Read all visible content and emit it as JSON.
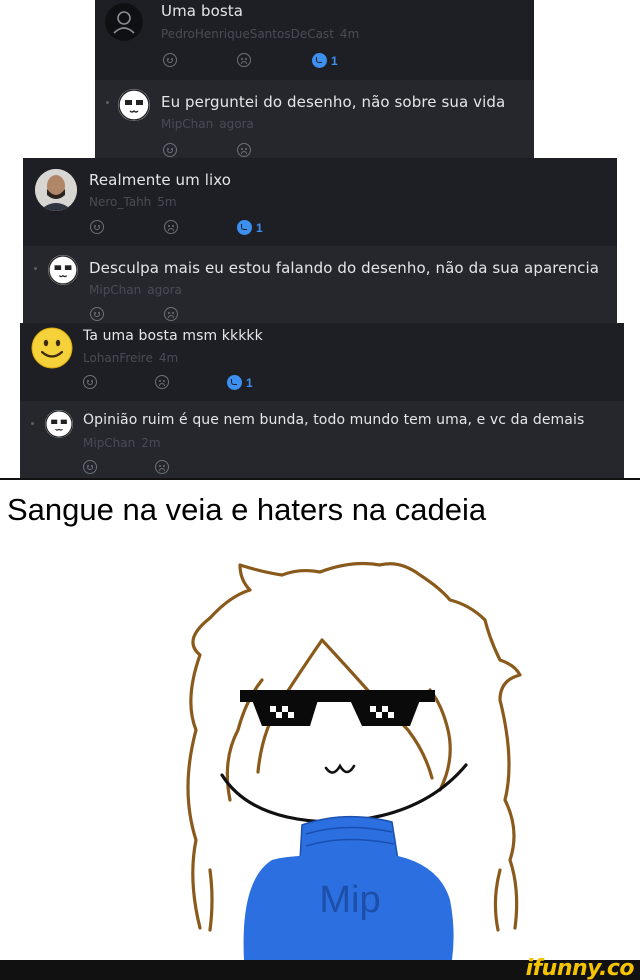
{
  "comments": [
    {
      "text": "Uma bosta",
      "user": "PedroHenriqueSantosDeCast",
      "time": "4m",
      "reply_count": "1",
      "reply": {
        "text": "Eu perguntei do desenho, não sobre sua vida",
        "user": "MipChan",
        "time": "agora"
      }
    },
    {
      "text": "Realmente um lixo",
      "user": "Nero_Tahh",
      "time": "5m",
      "reply_count": "1",
      "reply": {
        "text": "Desculpa mais eu estou falando do desenho, não da sua aparencia",
        "user": "MipChan",
        "time": "agora"
      }
    },
    {
      "text": "Ta uma bosta msm kkkkk",
      "user": "LohanFreire",
      "time": "4m",
      "reply_count": "1",
      "reply": {
        "text": "Opinião ruim é que nem bunda, todo mundo tem uma, e vc da demais",
        "user": "MipChan",
        "time": "2m"
      }
    }
  ],
  "caption": "Sangue na veia e haters na cadeia",
  "drawing": {
    "shirt_text": "Mip"
  },
  "watermark": "ifunny.co",
  "colors": {
    "panel_bg": "#1e1f24",
    "reply_bg": "#25272d",
    "accent": "#3d8ff0",
    "hair": "#8a5a1c",
    "shirt": "#2b6fe0"
  },
  "icons": [
    "user-placeholder-icon",
    "smile-react-icon",
    "frown-react-icon",
    "reply-bubble-icon"
  ]
}
